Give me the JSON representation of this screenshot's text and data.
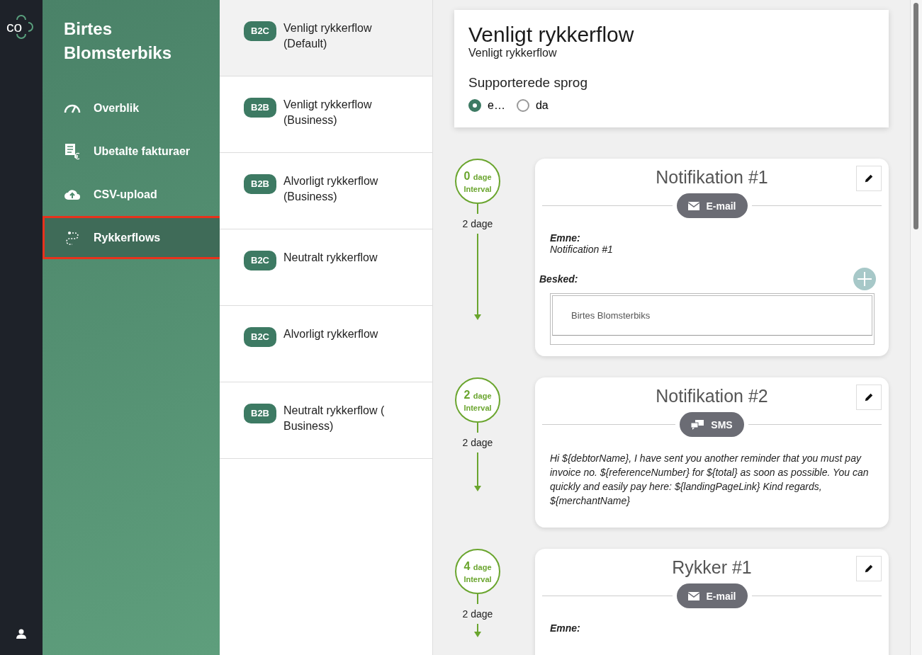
{
  "brand": {
    "logo_text": "co"
  },
  "sidebar": {
    "company": "Birtes Blomsterbiks",
    "items": [
      {
        "label": "Overblik",
        "selected": false
      },
      {
        "label": "Ubetalte fakturaer",
        "selected": false
      },
      {
        "label": "CSV-upload",
        "selected": false
      },
      {
        "label": "Rykkerflows",
        "selected": true
      }
    ]
  },
  "flows": [
    {
      "tag": "B2C",
      "name": "Venligt rykkerflow (Default)",
      "selected": true
    },
    {
      "tag": "B2B",
      "name": "Venligt rykkerflow (Business)",
      "selected": false
    },
    {
      "tag": "B2B",
      "name": "Alvorligt rykkerflow (Business)",
      "selected": false
    },
    {
      "tag": "B2C",
      "name": "Neutralt rykkerflow",
      "selected": false
    },
    {
      "tag": "B2C",
      "name": "Alvorligt rykkerflow",
      "selected": false
    },
    {
      "tag": "B2B",
      "name": "Neutralt rykkerflow ( Business)",
      "selected": false
    }
  ],
  "header": {
    "title": "Venligt rykkerflow",
    "subtitle": "Venligt rykkerflow",
    "languages_label": "Supporterede sprog",
    "languages": [
      {
        "label": "e…",
        "selected": true
      },
      {
        "label": "da",
        "selected": false
      }
    ]
  },
  "steps": [
    {
      "days": "0",
      "unit": "dage",
      "interval_label": "Interval",
      "gap": "2 dage",
      "title": "Notifikation #1",
      "channel": {
        "kind": "email",
        "label": "E-mail"
      },
      "subject_label": "Emne:",
      "subject": "Notification #1",
      "message_label": "Besked:",
      "editor_text": "Birtes Blomsterbiks"
    },
    {
      "days": "2",
      "unit": "dage",
      "interval_label": "Interval",
      "gap": "2 dage",
      "title": "Notifikation #2",
      "channel": {
        "kind": "sms",
        "label": "SMS"
      },
      "message": "Hi ${debtorName}, I have sent you another reminder that you must pay invoice no. ${referenceNumber} for ${total} as soon as possible. You can quickly and easily pay here: ${landingPageLink} Kind regards, ${merchantName}"
    },
    {
      "days": "4",
      "unit": "dage",
      "interval_label": "Interval",
      "gap": "2 dage",
      "title": "Rykker #1",
      "channel": {
        "kind": "email",
        "label": "E-mail"
      },
      "subject_label": "Emne:"
    }
  ]
}
